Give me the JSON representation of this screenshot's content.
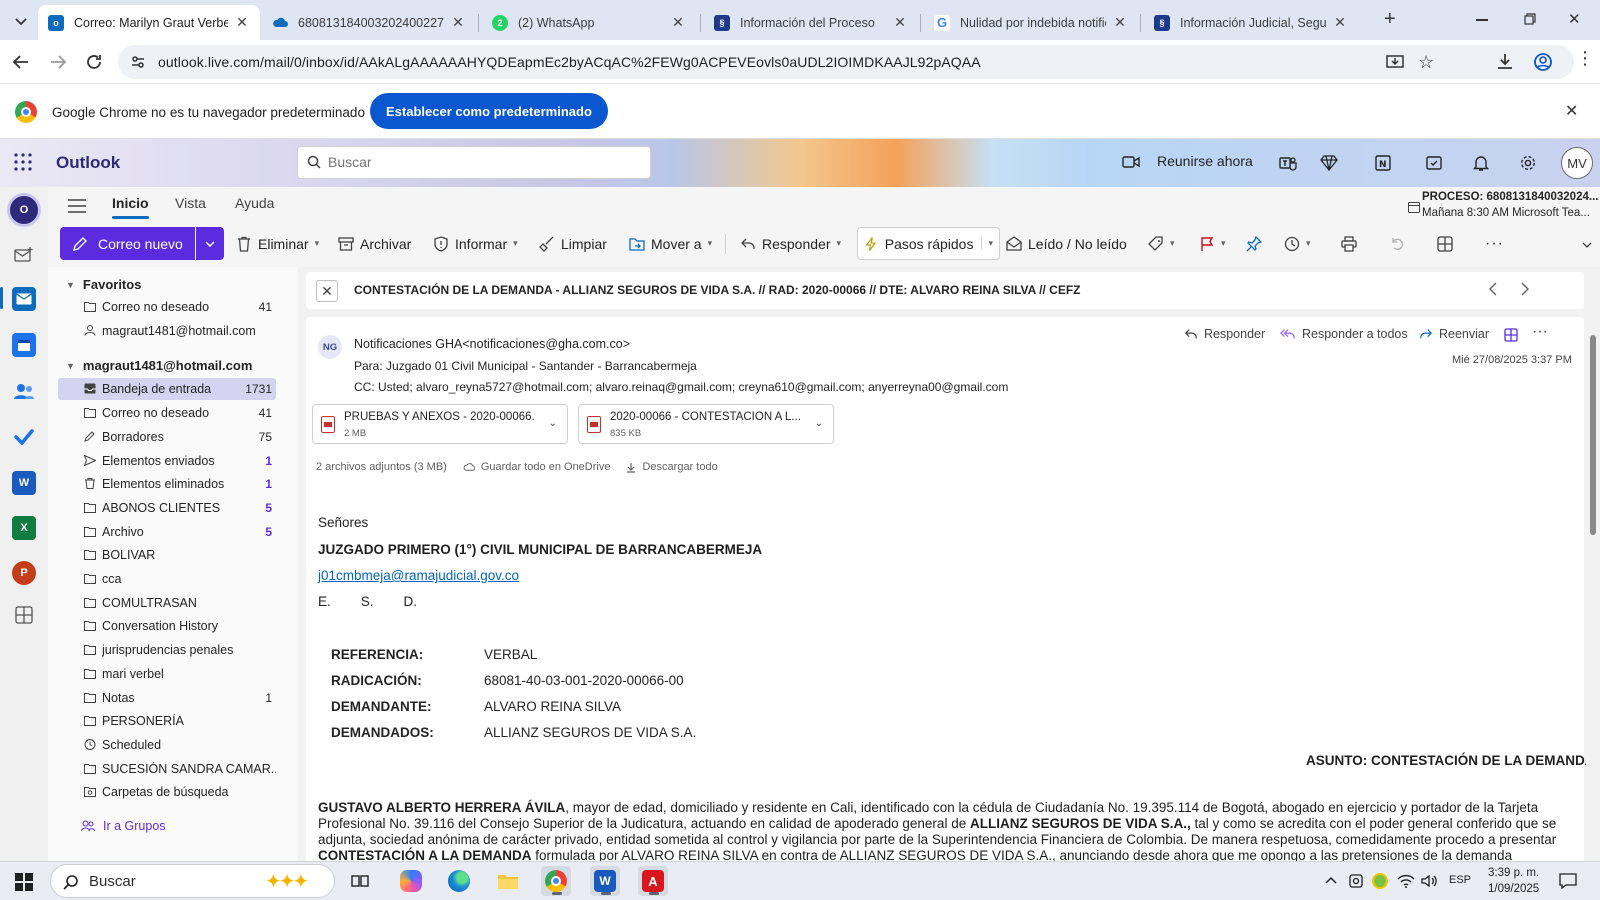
{
  "browser": {
    "tabs": [
      {
        "title": "Correo: Marilyn Graut Verbel",
        "icon": "outlook-icon"
      },
      {
        "title": "68081318400320240022700",
        "icon": "onedrive-icon"
      },
      {
        "title": "(2) WhatsApp",
        "icon": "whatsapp-icon"
      },
      {
        "title": "Información del Proceso",
        "icon": "rama-judicial-icon"
      },
      {
        "title": "Nulidad por indebida notific",
        "icon": "google-icon"
      },
      {
        "title": "Información Judicial, Seguim",
        "icon": "rama-judicial-icon"
      }
    ],
    "new_tab": "+",
    "url": "outlook.live.com/mail/0/inbox/id/AAkALgAAAAAAHYQDEapmEc2byACqAC%2FEWg0ACPEVEovls0aUDL2IOIMDKAAJL92pAQAA"
  },
  "default_bar": {
    "message": "Google Chrome no es tu navegador predeterminado",
    "button": "Establecer como predeterminado"
  },
  "outlook": {
    "brand": "Outlook",
    "search_placeholder": "Buscar",
    "meet_now": "Reunirse ahora",
    "avatar_initials": "MV"
  },
  "ribbon": {
    "tabs": [
      "Inicio",
      "Vista",
      "Ayuda"
    ],
    "proc_line1": "PROCESO: 6808131840032024...",
    "proc_line2": "Mañana 8:30 AM Microsoft Tea...",
    "new_mail": "Correo nuevo",
    "delete": "Eliminar",
    "archive": "Archivar",
    "report": "Informar",
    "sweep": "Limpiar",
    "move": "Mover a",
    "reply": "Responder",
    "quick_steps": "Pasos rápidos",
    "read_unread": "Leído / No leído",
    "more": "···"
  },
  "folders": {
    "favorites_label": "Favoritos",
    "favorites": [
      {
        "name": "Correo no deseado",
        "count": "41"
      },
      {
        "name": "magraut1481@hotmail.com",
        "count": ""
      }
    ],
    "account_label": "magraut1481@hotmail.com",
    "items": [
      {
        "name": "Bandeja de entrada",
        "count": "1731"
      },
      {
        "name": "Correo no deseado",
        "count": "41"
      },
      {
        "name": "Borradores",
        "count": "75"
      },
      {
        "name": "Elementos enviados",
        "count": "1"
      },
      {
        "name": "Elementos eliminados",
        "count": "1"
      },
      {
        "name": "ABONOS CLIENTES",
        "count": "5"
      },
      {
        "name": "Archivo",
        "count": "5"
      },
      {
        "name": "BOLIVAR",
        "count": ""
      },
      {
        "name": "cca",
        "count": ""
      },
      {
        "name": "COMULTRASAN",
        "count": ""
      },
      {
        "name": "Conversation History",
        "count": ""
      },
      {
        "name": "jurisprudencias penales",
        "count": ""
      },
      {
        "name": "mari verbel",
        "count": ""
      },
      {
        "name": "Notas",
        "count": "1"
      },
      {
        "name": "PERSONERÍA",
        "count": ""
      },
      {
        "name": "Scheduled",
        "count": ""
      },
      {
        "name": "SUCESIÓN SANDRA CAMAR...",
        "count": ""
      },
      {
        "name": "Carpetas de búsqueda",
        "count": ""
      }
    ],
    "groups_link": "Ir a Grupos"
  },
  "message": {
    "subject": "CONTESTACIÓN DE LA DEMANDA - ALLIANZ SEGUROS DE VIDA S.A. // RAD: 2020-00066 // DTE: ALVARO REINA SILVA // CEFZ",
    "sender_initials": "NG",
    "from": "Notificaciones GHA<notificaciones@gha.com.co>",
    "to": "Para:  Juzgado 01 Civil Municipal - Santander - Barrancabermeja",
    "cc": "CC:  Usted;  alvaro_reyna5727@hotmail.com;  alvaro.reinaq@gmail.com;  creyna610@gmail.com;  anyerreyna00@gmail.com",
    "date": "Mié 27/08/2025 3:37 PM",
    "actions": {
      "reply": "Responder",
      "reply_all": "Responder a todos",
      "forward": "Reenviar"
    },
    "attachments": [
      {
        "name": "PRUEBAS Y ANEXOS - 2020-00066...",
        "size": "2 MB"
      },
      {
        "name": "2020-00066 - CONTESTACION A L...",
        "size": "835 KB"
      }
    ],
    "attach_summary": "2 archivos adjuntos (3 MB)",
    "save_onedrive": "Guardar todo en OneDrive",
    "download_all": "Descargar todo",
    "body": {
      "greeting": "Señores",
      "court": "JUZGADO PRIMERO (1°) CIVIL MUNICIPAL DE BARRANCABERMEJA",
      "email": "j01cmbmeja@ramajudicial.gov.co",
      "esd": "E.        S.        D.",
      "refs": [
        {
          "k": "REFERENCIA:",
          "v": "VERBAL"
        },
        {
          "k": "RADICACIÓN:",
          "v": "68081-40-03-001-2020-00066-00"
        },
        {
          "k": "DEMANDANTE:",
          "v": "ALVARO REINA SILVA"
        },
        {
          "k": "DEMANDADOS:",
          "v": "ALLIANZ SEGUROS DE VIDA S.A."
        }
      ],
      "asunto_label": "ASUNTO",
      "asunto_value": ": CONTESTACIÓN DE LA DEMANDA",
      "p_name": "GUSTAVO ALBERTO HERRERA ÁVILA",
      "p_text1": ", mayor de edad, domiciliado y residente en Cali, identificado con la cédula de Ciudadanía No. 19.395.114 de Bogotá, abogado en ejercicio y portador de la Tarjeta Profesional No. 39.116 del Consejo Superior de la Judicatura, actuando en calidad de apoderado general de ",
      "p_company": "ALLIANZ SEGUROS DE VIDA S.A.,",
      "p_text2": " tal y como se acredita con el poder general conferido que se adjunta, sociedad anónima de carácter privado, entidad sometida al control y vigilancia por parte de la Superintendencia Financiera de Colombia. De manera respetuosa, comedidamente procedo a presentar ",
      "p_bold2": "CONTESTACIÓN A LA DEMANDA",
      "p_text3": " formulada por ALVARO REINA SILVA en contra de ALLIANZ SEGUROS DE VIDA S.A., anunciando desde ahora que me opongo a las pretensiones de la demanda"
    }
  },
  "taskbar": {
    "search": "Buscar",
    "lang": "ESP",
    "time": "3:39 p. m.",
    "date": "1/09/2025"
  }
}
